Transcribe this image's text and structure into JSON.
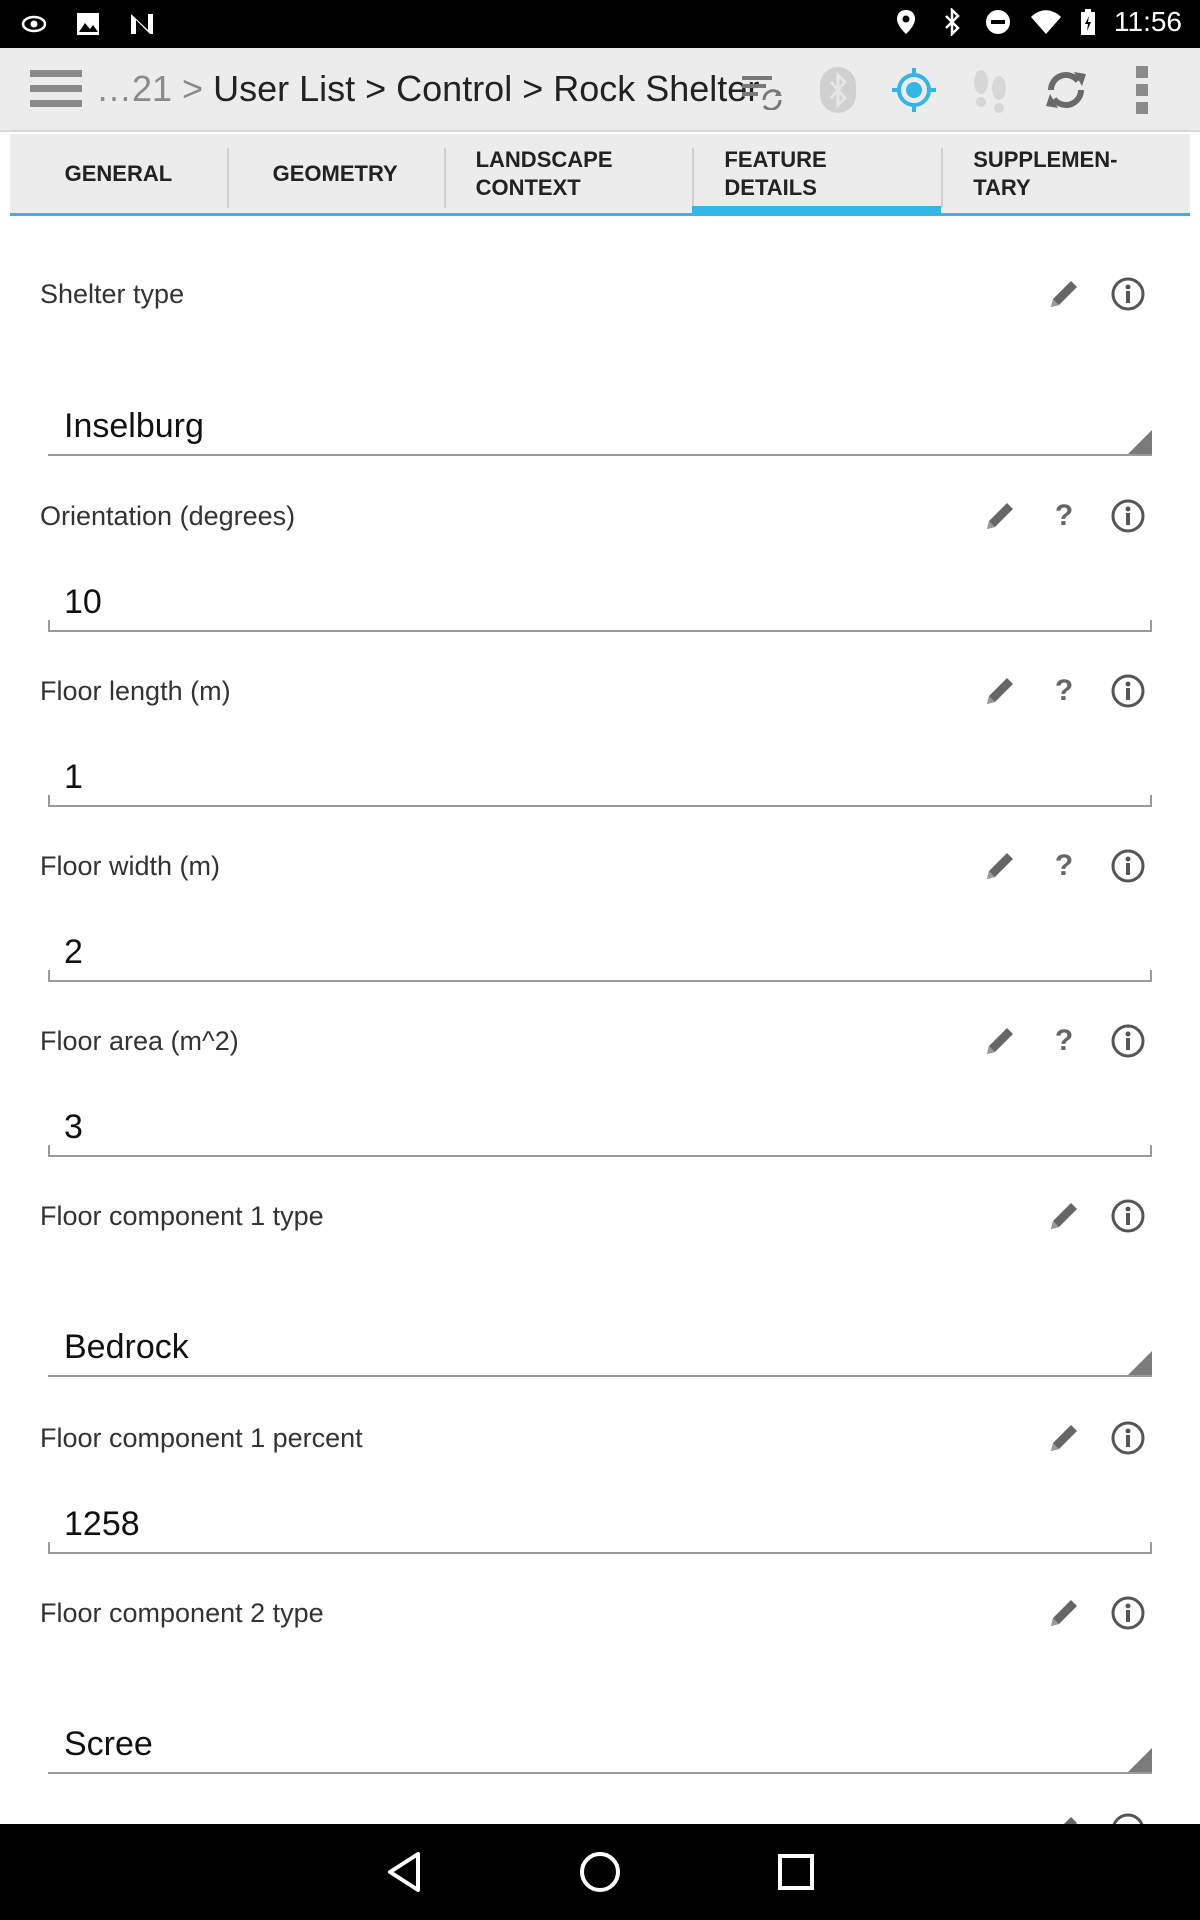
{
  "status_bar": {
    "time": "11:56",
    "left_icons": [
      "vision-icon",
      "image-icon",
      "n-icon"
    ],
    "right_icons": [
      "location-icon",
      "bluetooth-icon",
      "do-not-disturb-icon",
      "wifi-icon",
      "battery-icon"
    ]
  },
  "action_bar": {
    "breadcrumb_prefix": "…21 >",
    "breadcrumb_main": "User List > Control > Rock Shelter",
    "icons": [
      "sync-list-icon",
      "bluetooth-icon",
      "gps-icon",
      "footsteps-icon",
      "refresh-icon",
      "overflow-menu-icon"
    ],
    "accent_color": "#33b5e5"
  },
  "tabs": [
    {
      "label": "GENERAL",
      "active": false
    },
    {
      "label": "GEOMETRY",
      "active": false
    },
    {
      "label": "LANDSCAPE\nCONTEXT",
      "active": false
    },
    {
      "label": "FEATURE\nDETAILS",
      "active": true
    },
    {
      "label": "SUPPLEMEN-\nTARY",
      "active": false
    }
  ],
  "fields": [
    {
      "label": "Shelter type",
      "value": "Inselburg",
      "kind": "select",
      "has_help": false
    },
    {
      "label": "Orientation (degrees)",
      "value": "10",
      "kind": "text",
      "has_help": true
    },
    {
      "label": "Floor length (m)",
      "value": "1",
      "kind": "text",
      "has_help": true
    },
    {
      "label": "Floor width (m)",
      "value": "2",
      "kind": "text",
      "has_help": true
    },
    {
      "label": "Floor area (m^2)",
      "value": "3",
      "kind": "text",
      "has_help": true
    },
    {
      "label": "Floor component 1 type",
      "value": "Bedrock",
      "kind": "select",
      "has_help": false
    },
    {
      "label": "Floor component 1 percent",
      "value": "1258",
      "kind": "text",
      "has_help": false
    },
    {
      "label": "Floor component 2 type",
      "value": "Scree",
      "kind": "select",
      "has_help": false
    }
  ],
  "help_mark": "?",
  "nav_bar": {
    "buttons": [
      "back-icon",
      "home-icon",
      "recents-icon"
    ]
  }
}
